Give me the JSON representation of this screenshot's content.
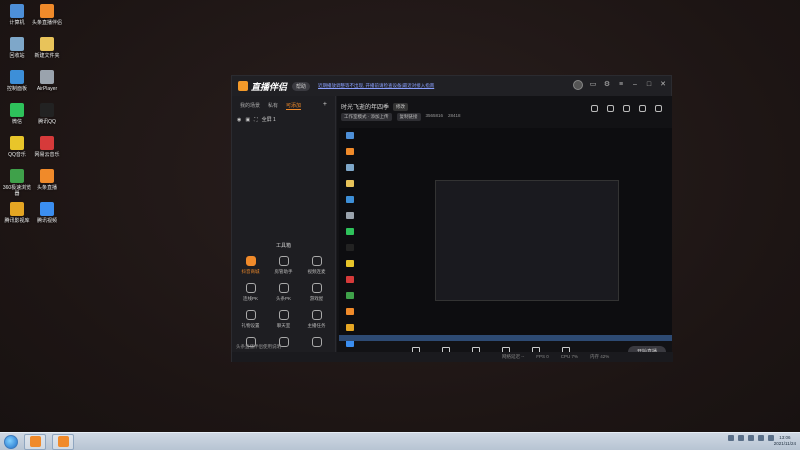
{
  "desktop": {
    "icons": [
      {
        "label": "计算机",
        "color": "#4d8fd8"
      },
      {
        "label": "头条直播伴侣",
        "color": "#f08a2a"
      },
      {
        "label": "回收站",
        "color": "#7ea7c9"
      },
      {
        "label": "新建文件夹",
        "color": "#e8c35a"
      },
      {
        "label": "控制面板",
        "color": "#3d8fd8"
      },
      {
        "label": "AirPlayer",
        "color": "#9aa3ad"
      },
      {
        "label": "微信",
        "color": "#2ec25b"
      },
      {
        "label": "腾讯QQ",
        "color": "#222222"
      },
      {
        "label": "QQ音乐",
        "color": "#e8c52a"
      },
      {
        "label": "网易云音乐",
        "color": "#d63a3a"
      },
      {
        "label": "360极速浏览器",
        "color": "#3fa14a"
      },
      {
        "label": "头条直播",
        "color": "#f08a2a"
      },
      {
        "label": "腾讯影视库",
        "color": "#e5a623"
      },
      {
        "label": "腾讯视频",
        "color": "#3b8ef0"
      }
    ]
  },
  "app": {
    "logo_text": "直播伴侣",
    "help_label": "帮助",
    "notice": "近期播放调整等不出现, 开播前请检查设备|最近对接入指南",
    "tabs": [
      "我的场景",
      "私有",
      "可添加"
    ],
    "add_tab": "+",
    "scene_name": "全屏 1",
    "stream_title": "时光飞逝的年四季",
    "edit_label": "修改",
    "meta_mode": "工作室模式 · 添加上传",
    "meta_link": "复制链接",
    "meta_id": "3565816",
    "meta_fans": "28418",
    "toolbox_title": "工具箱",
    "tools": [
      {
        "label": "抖音商城",
        "accent": true
      },
      {
        "label": "房管助手",
        "accent": false
      },
      {
        "label": "视频连麦",
        "accent": false
      },
      {
        "label": "连线PK",
        "accent": false
      },
      {
        "label": "头条PK",
        "accent": false
      },
      {
        "label": "游戏屋",
        "accent": false
      },
      {
        "label": "礼物设置",
        "accent": false
      },
      {
        "label": "聊天室",
        "accent": false
      },
      {
        "label": "主播任务",
        "accent": false
      },
      {
        "label": "",
        "accent": false
      },
      {
        "label": "",
        "accent": false
      },
      {
        "label": "",
        "accent": false
      }
    ],
    "left_footer": "头条直播伴侣使用说明",
    "controls": [
      "直播屏幕",
      "摄像头",
      "手机投屏",
      "录播放",
      "麦克风",
      "扬声器"
    ],
    "start_label": "开始直播",
    "stats": [
      "网络延迟 --",
      "FPS 0",
      "CPU 7%",
      "内存 42%"
    ]
  },
  "taskbar": {
    "time": "13:06",
    "date": "2021/11/24"
  }
}
